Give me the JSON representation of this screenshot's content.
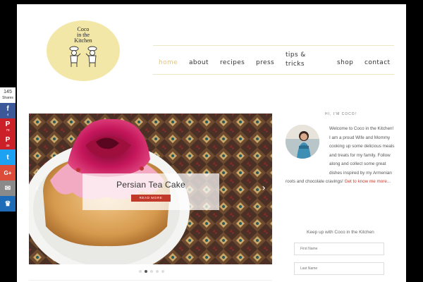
{
  "logo": {
    "lines": [
      "Coco",
      "in the",
      "Kitchen"
    ],
    "bg": "#f2e7a6"
  },
  "nav": {
    "items": [
      {
        "label": "home",
        "active": true
      },
      {
        "label": "about"
      },
      {
        "label": "recipes"
      },
      {
        "label": "press"
      },
      {
        "label": "tips &\ntricks"
      },
      {
        "label": "shop"
      },
      {
        "label": "contact"
      }
    ],
    "active_color": "#e2c57d"
  },
  "slider": {
    "title": "Persian Tea Cake",
    "read_more": "READ MORE",
    "prev_icon": "chevron-left-icon",
    "next_icon": "chevron-right-icon",
    "dots": 5,
    "active_dot": 1
  },
  "sidebar": {
    "hi": "HI, I'M COCO!",
    "welcome": "Welcome to Coco in the Kitchen! I am a proud Wife and Mommy cooking up some delicious meals and treats for my family. Follow along and collect some great dishes inspired by my Armenian roots and chocolate cravings!",
    "link": "Get to know me more...",
    "keep_up": "Keep up with Coco in the Kitchen",
    "first_name_placeholder": "First Name",
    "last_name_placeholder": "Last Name"
  },
  "share": {
    "count": "145",
    "label": "Shares",
    "buttons": [
      {
        "network": "facebook",
        "icon": "facebook-icon",
        "glyph": "f",
        "count": "4",
        "color": "#3b5998"
      },
      {
        "network": "pinterest",
        "icon": "pinterest-icon",
        "glyph": "P",
        "count": "79",
        "color": "#cb2027"
      },
      {
        "network": "pinterest-alt",
        "icon": "pin-icon",
        "glyph": "P",
        "count": "39",
        "color": "#cb2027"
      },
      {
        "network": "twitter",
        "icon": "twitter-icon",
        "glyph": "t",
        "count": "",
        "color": "#1da1f2"
      },
      {
        "network": "google-plus",
        "icon": "google-plus-icon",
        "glyph": "G+",
        "count": "",
        "color": "#dd4b39"
      },
      {
        "network": "email",
        "icon": "email-icon",
        "glyph": "✉",
        "count": "",
        "color": "#8a8a8a"
      },
      {
        "network": "sumo",
        "icon": "crown-icon",
        "glyph": "♛",
        "count": "",
        "color": "#1e6bb8"
      }
    ]
  }
}
